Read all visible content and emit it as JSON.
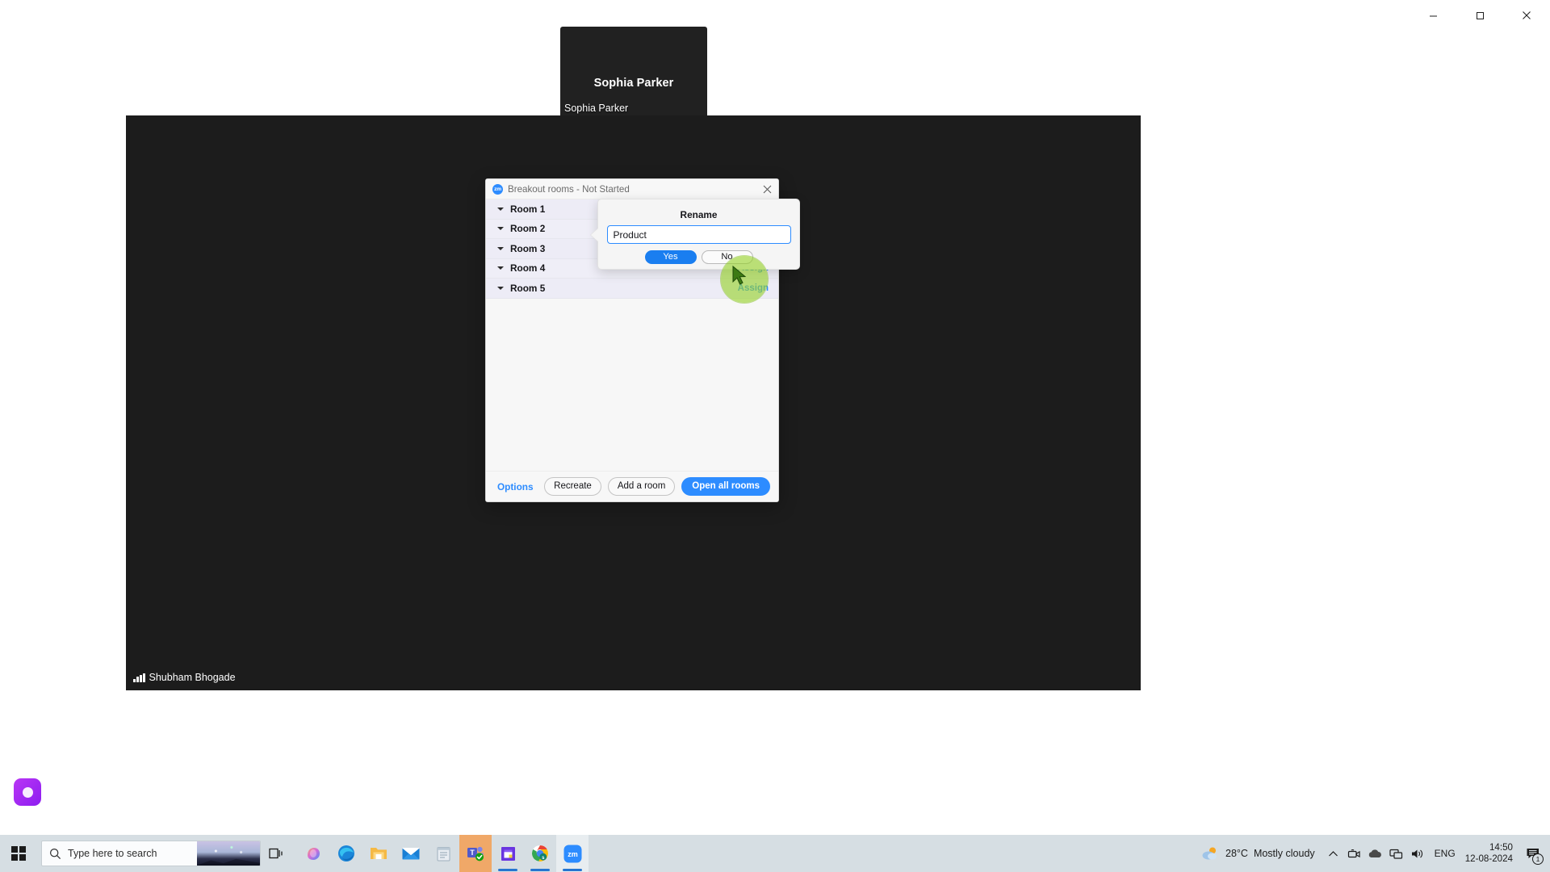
{
  "window_controls": {
    "minimize": "minimize-icon",
    "maximize": "maximize-icon",
    "close": "close-icon"
  },
  "video_tile": {
    "center_name": "Sophia Parker",
    "corner_name": "Sophia Parker"
  },
  "meeting": {
    "self_name": "Shubham Bhogade",
    "signal_icon": "signal-strength-icon"
  },
  "breakout": {
    "app_icon": "zoom-logo-icon",
    "app_icon_text": "zm",
    "title": "Breakout rooms - Not Started",
    "close_icon": "close-icon",
    "rooms": [
      {
        "name": "Room 1",
        "assign": ""
      },
      {
        "name": "Room 2",
        "assign": ""
      },
      {
        "name": "Room 3",
        "assign": ""
      },
      {
        "name": "Room 4",
        "assign": "Assign"
      },
      {
        "name": "Room 5",
        "assign": "Assign"
      }
    ],
    "footer": {
      "options": "Options",
      "recreate": "Recreate",
      "add_room": "Add a room",
      "open_all": "Open all rooms"
    }
  },
  "rename_popup": {
    "title": "Rename",
    "input_value": "Product",
    "input_placeholder": "",
    "yes": "Yes",
    "no": "No"
  },
  "taskbar": {
    "start_icon": "windows-start-icon",
    "search_placeholder": "Type here to search",
    "search_icon": "search-icon",
    "taskview_icon": "task-view-icon",
    "apps": [
      {
        "name": "copilot",
        "label": "Copilot"
      },
      {
        "name": "edge",
        "label": "Microsoft Edge"
      },
      {
        "name": "file-explorer",
        "label": "File Explorer"
      },
      {
        "name": "mail",
        "label": "Mail"
      },
      {
        "name": "notepad",
        "label": "Notepad"
      },
      {
        "name": "teams",
        "label": "Microsoft Teams"
      },
      {
        "name": "purple-app",
        "label": "App"
      },
      {
        "name": "chrome",
        "label": "Google Chrome"
      },
      {
        "name": "zoom",
        "label": "Zoom"
      }
    ],
    "tray": {
      "weather_temp": "28°C",
      "weather_desc": "Mostly cloudy",
      "weather_icon": "partly-cloudy-icon",
      "chevron_icon": "chevron-up-icon",
      "camera_icon": "camera-icon",
      "cloud_icon": "onedrive-icon",
      "network_icon": "network-icon",
      "volume_icon": "volume-icon",
      "language": "ENG",
      "time": "14:50",
      "date": "12-08-2024",
      "notification_icon": "notification-icon",
      "notification_count": "1"
    }
  },
  "colors": {
    "accent_blue": "#2d8cff",
    "highlight_green": "#96d228",
    "dark_bg": "#1c1c1c",
    "taskbar": "#d6dee3"
  }
}
